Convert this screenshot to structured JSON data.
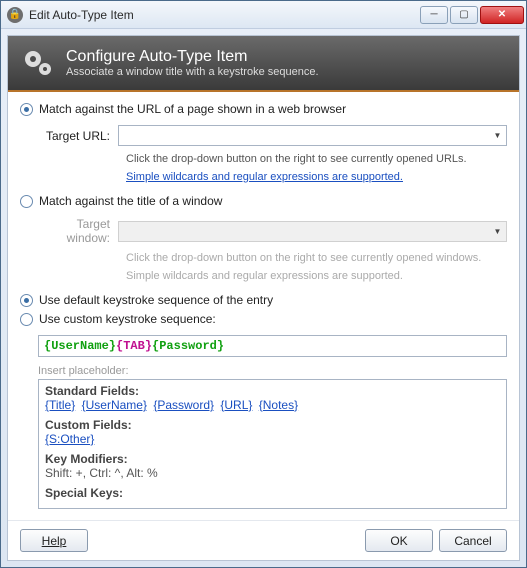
{
  "window_title": "Edit Auto-Type Item",
  "banner": {
    "title": "Configure Auto-Type Item",
    "subtitle": "Associate a window title with a keystroke sequence."
  },
  "match_url": {
    "radio_label": "Match against the URL of a page shown in a web browser",
    "field_label": "Target URL:",
    "value": "",
    "hint": "Click the drop-down button on the right to see currently opened URLs.",
    "link": "Simple wildcards and regular expressions are supported."
  },
  "match_window": {
    "radio_label": "Match against the title of a window",
    "field_label": "Target window:",
    "value": "",
    "hint": "Click the drop-down button on the right to see currently opened windows.",
    "hint2": "Simple wildcards and regular expressions are supported."
  },
  "sequence": {
    "default_label": "Use default keystroke sequence of the entry",
    "custom_label": "Use custom keystroke sequence:",
    "value_username": "{UserName}",
    "value_tab": "{TAB}",
    "value_password": "{Password}",
    "insert_label": "Insert placeholder:"
  },
  "placeholders": {
    "standard_heading": "Standard Fields:",
    "standard": [
      "{Title}",
      "{UserName}",
      "{Password}",
      "{URL}",
      "{Notes}"
    ],
    "custom_heading": "Custom Fields:",
    "custom": [
      "{S:Other}"
    ],
    "keymod_heading": "Key Modifiers:",
    "keymod_text": "Shift: +, Ctrl: ^, Alt: %",
    "special_heading": "Special Keys:"
  },
  "buttons": {
    "help": "Help",
    "ok": "OK",
    "cancel": "Cancel"
  }
}
